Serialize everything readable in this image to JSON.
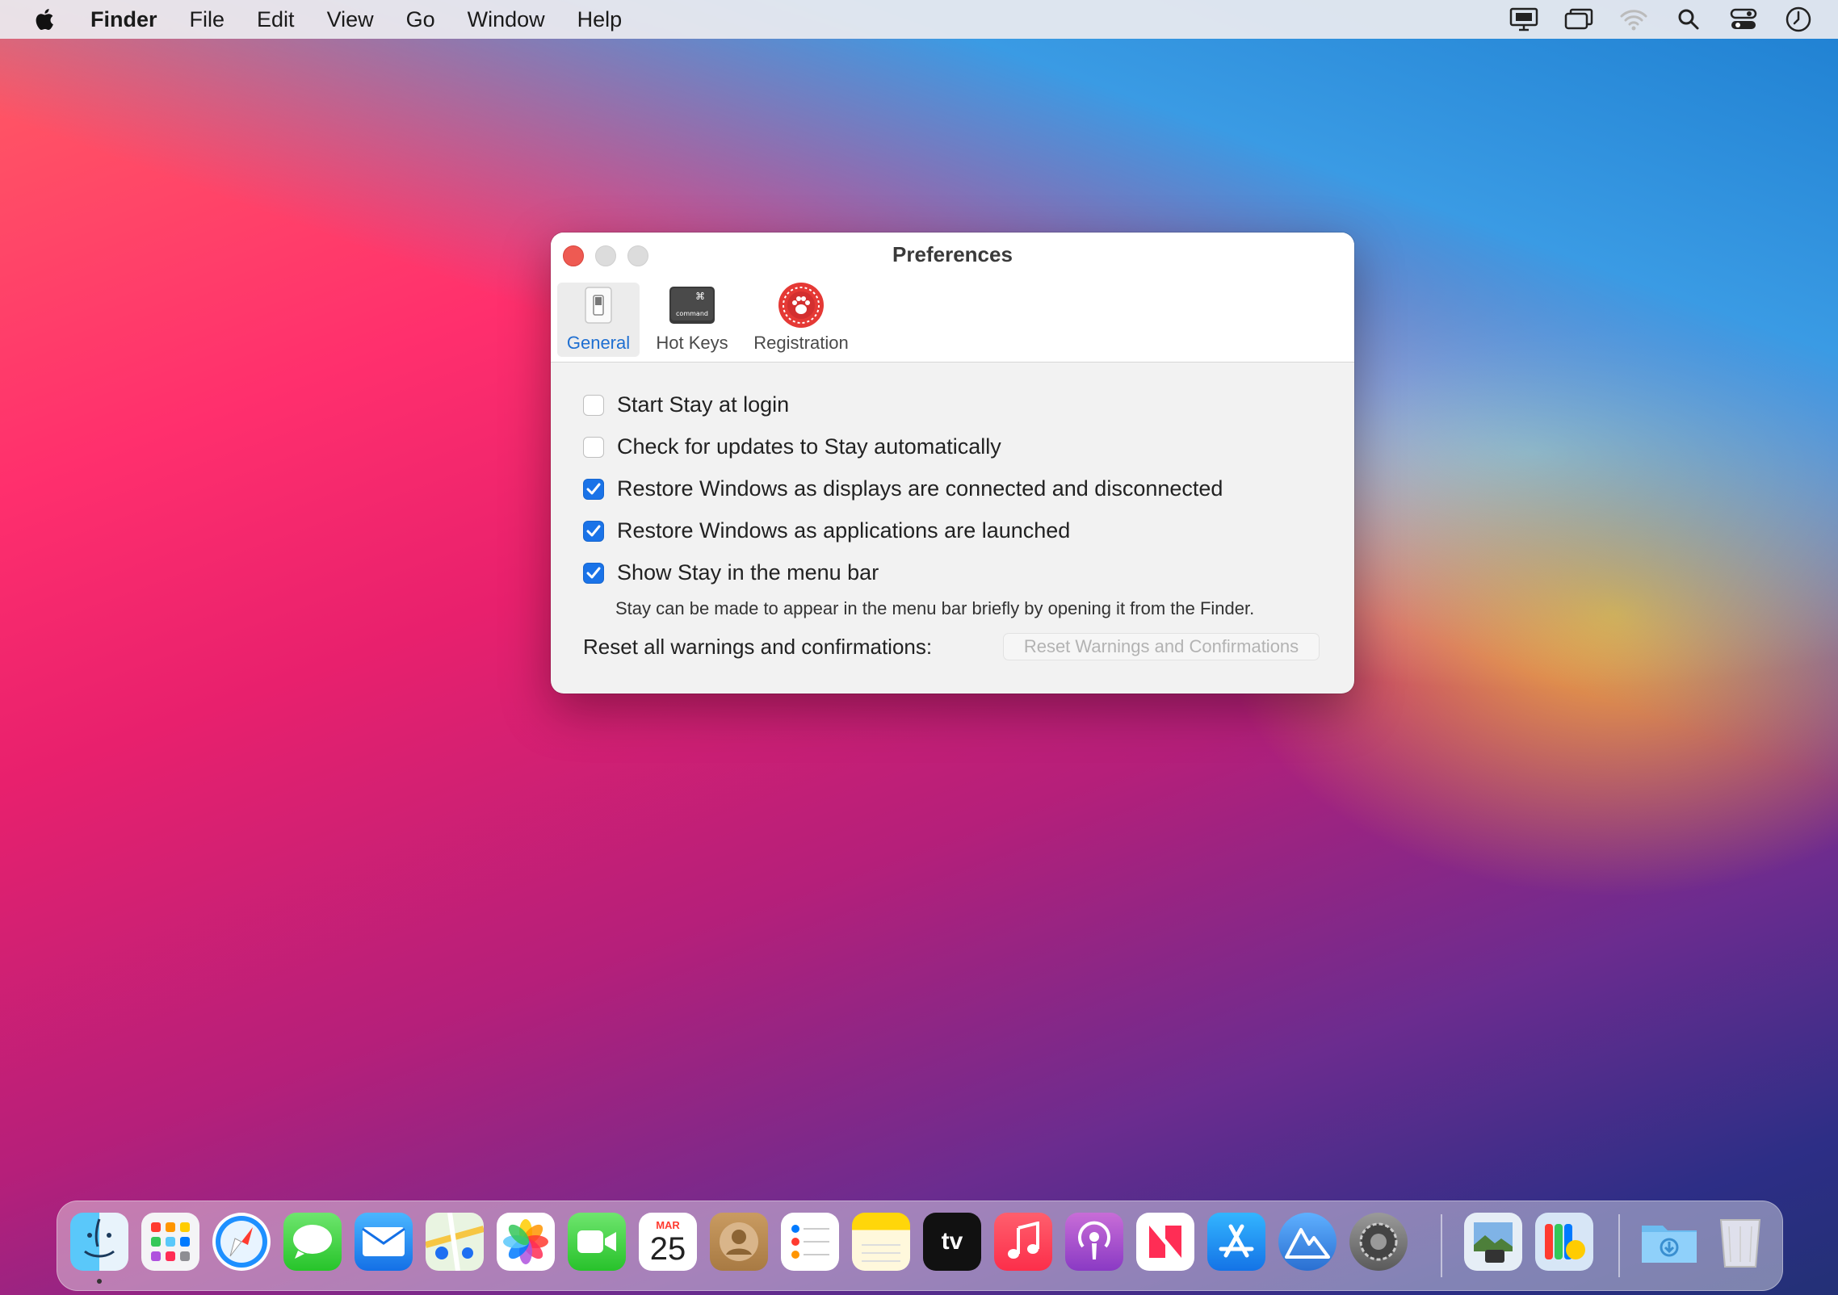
{
  "menubar": {
    "app_name": "Finder",
    "items": [
      "File",
      "Edit",
      "View",
      "Go",
      "Window",
      "Help"
    ],
    "status_icons": [
      "display-icon",
      "screen-mirroring-icon",
      "wifi-icon",
      "search-icon",
      "control-center-icon",
      "clock-icon"
    ]
  },
  "window": {
    "title": "Preferences",
    "tabs": [
      {
        "label": "General",
        "icon": "switch-icon",
        "active": true
      },
      {
        "label": "Hot Keys",
        "icon": "command-key-icon",
        "active": false
      },
      {
        "label": "Registration",
        "icon": "paw-seal-icon",
        "active": false
      }
    ],
    "options": [
      {
        "label": "Start Stay at login",
        "checked": false
      },
      {
        "label": "Check for updates to Stay automatically",
        "checked": false
      },
      {
        "label": "Restore Windows as displays are connected and disconnected",
        "checked": true
      },
      {
        "label": "Restore Windows as applications are launched",
        "checked": true
      },
      {
        "label": "Show Stay in the menu bar",
        "checked": true
      }
    ],
    "note": "Stay can be made to appear in the menu bar briefly by opening it from the Finder.",
    "reset_label": "Reset all warnings and confirmations:",
    "reset_button": "Reset Warnings and Confirmations"
  },
  "dock": {
    "apps": [
      "finder",
      "launchpad",
      "safari",
      "messages",
      "mail",
      "maps",
      "photos",
      "facetime",
      "calendar",
      "contacts",
      "reminders",
      "notes",
      "apple-tv",
      "music",
      "podcasts",
      "news",
      "app-store",
      "mountain-app",
      "system-preferences",
      "preview",
      "color-sync",
      "downloads",
      "trash"
    ],
    "calendar_month": "MAR",
    "calendar_day": "25",
    "tv_label": "tv"
  },
  "colors": {
    "accent": "#1a73e8",
    "close": "#ee5a52",
    "registration_red": "#e53935"
  }
}
